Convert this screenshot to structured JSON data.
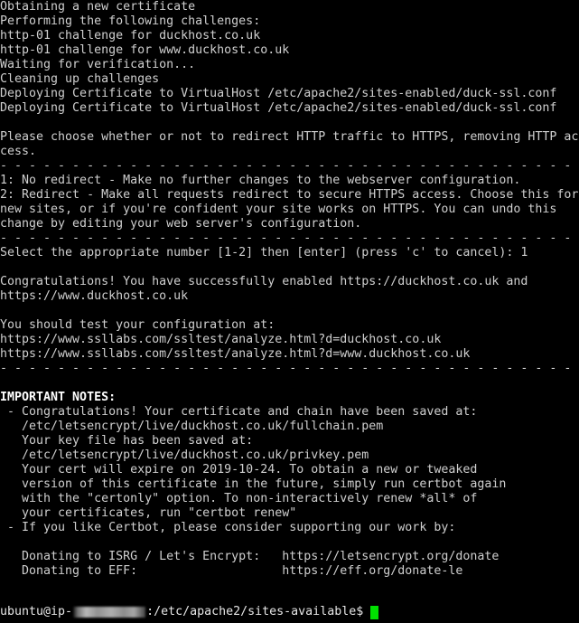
{
  "terminal": {
    "background_color": "#000000",
    "text_color": "#cfcfcf",
    "bright_text_color": "#ffffff",
    "cursor_color": "#00e000",
    "columns": 80,
    "rows": 43
  },
  "output": {
    "lines": [
      {
        "text": "Obtaining a new certificate",
        "style": "normal"
      },
      {
        "text": "Performing the following challenges:",
        "style": "normal"
      },
      {
        "text": "http-01 challenge for duckhost.co.uk",
        "style": "normal"
      },
      {
        "text": "http-01 challenge for www.duckhost.co.uk",
        "style": "normal"
      },
      {
        "text": "Waiting for verification...",
        "style": "normal"
      },
      {
        "text": "Cleaning up challenges",
        "style": "normal"
      },
      {
        "text": "Deploying Certificate to VirtualHost /etc/apache2/sites-enabled/duck-ssl.conf",
        "style": "normal"
      },
      {
        "text": "Deploying Certificate to VirtualHost /etc/apache2/sites-enabled/duck-ssl.conf",
        "style": "normal"
      },
      {
        "text": "",
        "style": "blank"
      },
      {
        "text": "Please choose whether or not to redirect HTTP traffic to HTTPS, removing HTTP ac",
        "style": "normal"
      },
      {
        "text": "cess.",
        "style": "normal"
      },
      {
        "text": "- - - - - - - - - - - - - - - - - - - - - - - - - - - - - - - - - - - - - - - -",
        "style": "normal"
      },
      {
        "text": "1: No redirect - Make no further changes to the webserver configuration.",
        "style": "normal"
      },
      {
        "text": "2: Redirect - Make all requests redirect to secure HTTPS access. Choose this for",
        "style": "normal"
      },
      {
        "text": "new sites, or if you're confident your site works on HTTPS. You can undo this",
        "style": "normal"
      },
      {
        "text": "change by editing your web server's configuration.",
        "style": "normal"
      },
      {
        "text": "- - - - - - - - - - - - - - - - - - - - - - - - - - - - - - - - - - - - - - - -",
        "style": "normal"
      },
      {
        "text": "Select the appropriate number [1-2] then [enter] (press 'c' to cancel): 1",
        "style": "normal"
      },
      {
        "text": "",
        "style": "blank"
      },
      {
        "text": "Congratulations! You have successfully enabled https://duckhost.co.uk and",
        "style": "normal"
      },
      {
        "text": "https://www.duckhost.co.uk",
        "style": "normal"
      },
      {
        "text": "",
        "style": "blank"
      },
      {
        "text": "You should test your configuration at:",
        "style": "normal"
      },
      {
        "text": "https://www.ssllabs.com/ssltest/analyze.html?d=duckhost.co.uk",
        "style": "normal"
      },
      {
        "text": "https://www.ssllabs.com/ssltest/analyze.html?d=www.duckhost.co.uk",
        "style": "normal"
      },
      {
        "text": "- - - - - - - - - - - - - - - - - - - - - - - - - - - - - - - - - - - - - - - -",
        "style": "normal"
      },
      {
        "text": "",
        "style": "blank"
      },
      {
        "text": "IMPORTANT NOTES:",
        "style": "bold"
      },
      {
        "text": " - Congratulations! Your certificate and chain have been saved at:",
        "style": "normal"
      },
      {
        "text": "   /etc/letsencrypt/live/duckhost.co.uk/fullchain.pem",
        "style": "normal"
      },
      {
        "text": "   Your key file has been saved at:",
        "style": "normal"
      },
      {
        "text": "   /etc/letsencrypt/live/duckhost.co.uk/privkey.pem",
        "style": "normal"
      },
      {
        "text": "   Your cert will expire on 2019-10-24. To obtain a new or tweaked",
        "style": "normal"
      },
      {
        "text": "   version of this certificate in the future, simply run certbot again",
        "style": "normal"
      },
      {
        "text": "   with the \"certonly\" option. To non-interactively renew *all* of",
        "style": "normal"
      },
      {
        "text": "   your certificates, run \"certbot renew\"",
        "style": "normal"
      },
      {
        "text": " - If you like Certbot, please consider supporting our work by:",
        "style": "normal"
      },
      {
        "text": "",
        "style": "blank"
      },
      {
        "text": "   Donating to ISRG / Let's Encrypt:   https://letsencrypt.org/donate",
        "style": "normal"
      },
      {
        "text": "   Donating to EFF:                    https://eff.org/donate-le",
        "style": "normal"
      },
      {
        "text": "",
        "style": "blank"
      },
      {
        "text": "",
        "style": "blank"
      }
    ]
  },
  "prompt": {
    "user_host_prefix": "ubuntu@ip-",
    "redacted_label": "redacted-ip-address",
    "path_and_symbol": ":/etc/apache2/sites-available$",
    "input_value": ""
  }
}
